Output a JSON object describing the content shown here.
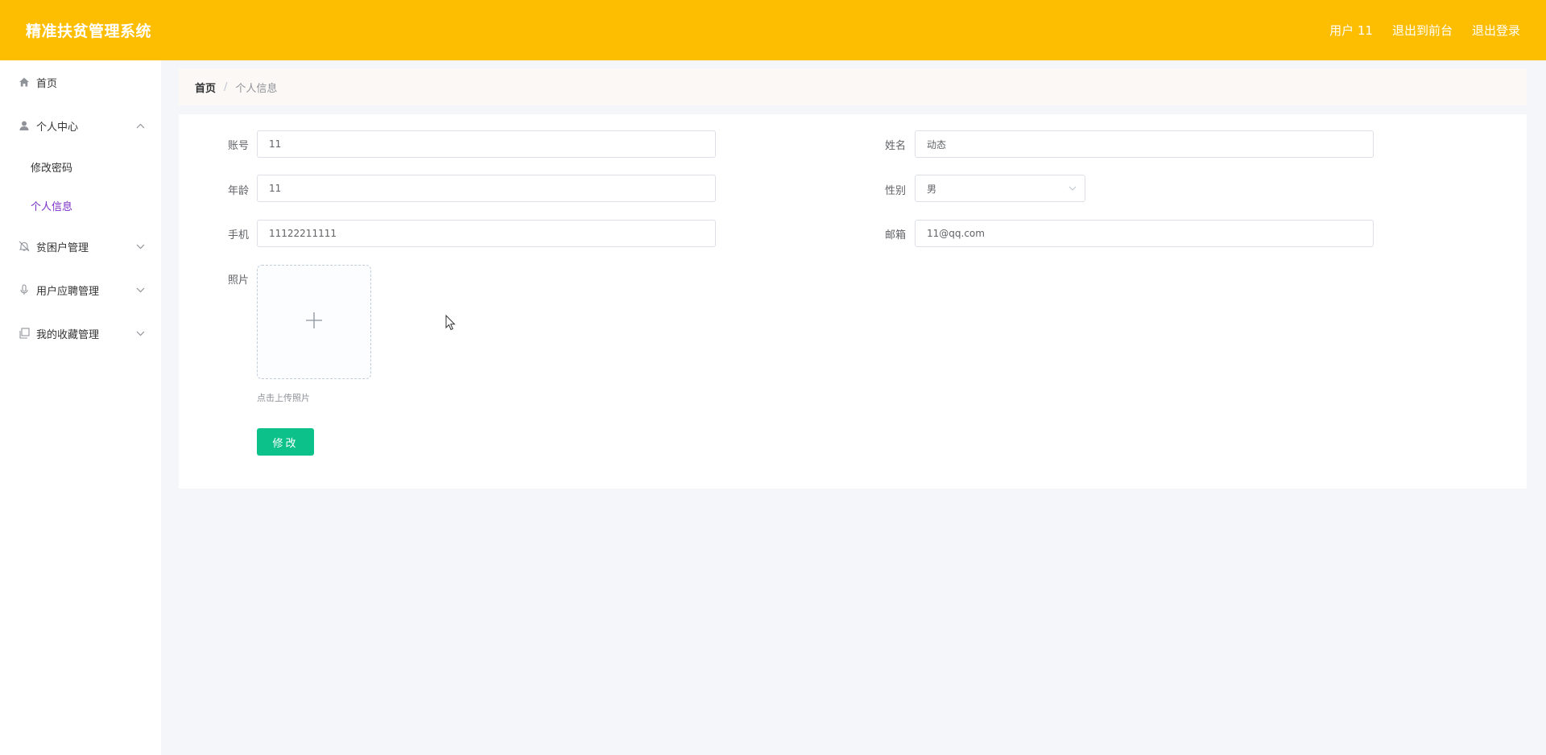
{
  "header": {
    "title": "精准扶贫管理系统",
    "user_label": "用户 11",
    "to_front_label": "退出到前台",
    "logout_label": "退出登录"
  },
  "sidebar": {
    "items": [
      {
        "label": "首页",
        "icon": "home-icon"
      },
      {
        "label": "个人中心",
        "icon": "user-icon",
        "expanded": true,
        "children": [
          {
            "label": "修改密码"
          },
          {
            "label": "个人信息",
            "active": true
          }
        ]
      },
      {
        "label": "贫困户管理",
        "icon": "bell-icon"
      },
      {
        "label": "用户应聘管理",
        "icon": "microphone-icon"
      },
      {
        "label": "我的收藏管理",
        "icon": "copy-icon"
      }
    ]
  },
  "breadcrumb": {
    "home": "首页",
    "separator": "/",
    "current": "个人信息"
  },
  "form": {
    "account_label": "账号",
    "account_value": "11",
    "name_label": "姓名",
    "name_value": "动态",
    "age_label": "年龄",
    "age_value": "11",
    "gender_label": "性别",
    "gender_value": "男",
    "phone_label": "手机",
    "phone_value": "11122211111",
    "email_label": "邮箱",
    "email_value": "11@qq.com",
    "photo_label": "照片",
    "upload_hint": "点击上传照片",
    "submit_label": "修改"
  },
  "colors": {
    "header_bg": "#fdbd00",
    "active_menu": "#7b2fc7",
    "submit_bg": "#0dc28a"
  }
}
